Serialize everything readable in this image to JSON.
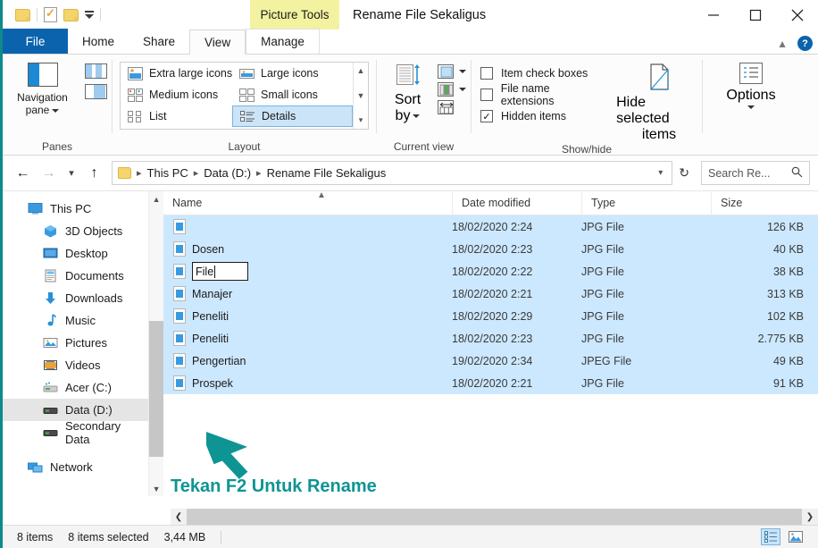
{
  "window": {
    "title": "Rename File Sekaligus",
    "contextual_tab": "Picture Tools",
    "minimize_icon": "minimize-icon",
    "maximize_icon": "maximize-icon",
    "close_icon": "close-icon"
  },
  "quick_access": {
    "folder_icon": "folder-icon",
    "properties_icon": "properties-icon",
    "new_folder_icon": "new-folder-icon",
    "customize_icon": "chevron-down-icon"
  },
  "tabs": [
    {
      "label": "File",
      "state": "file"
    },
    {
      "label": "Home",
      "state": "normal"
    },
    {
      "label": "Share",
      "state": "normal"
    },
    {
      "label": "View",
      "state": "active"
    },
    {
      "label": "Manage",
      "state": "contextual"
    }
  ],
  "ribbon": {
    "collapse_icon": "chevron-up-icon",
    "help_label": "?",
    "groups": {
      "panes": {
        "label": "Panes",
        "navigation_pane": "Navigation\npane",
        "navigation_pane_line1": "Navigation",
        "navigation_pane_line2": "pane"
      },
      "layout": {
        "label": "Layout",
        "items": [
          {
            "label": "Extra large icons",
            "selected": false
          },
          {
            "label": "Large icons",
            "selected": false
          },
          {
            "label": "Medium icons",
            "selected": false
          },
          {
            "label": "Small icons",
            "selected": false
          },
          {
            "label": "List",
            "selected": false
          },
          {
            "label": "Details",
            "selected": true
          }
        ]
      },
      "current_view": {
        "label": "Current view",
        "sort_by_line1": "Sort",
        "sort_by_line2": "by"
      },
      "show_hide": {
        "label": "Show/hide",
        "checkboxes": [
          {
            "label": "Item check boxes",
            "checked": false
          },
          {
            "label": "File name extensions",
            "checked": false
          },
          {
            "label": "Hidden items",
            "checked": true
          }
        ],
        "hide_selected_line1": "Hide selected",
        "hide_selected_line2": "items"
      },
      "options": {
        "label": "Options"
      }
    }
  },
  "address": {
    "back_icon": "back-arrow-icon",
    "forward_icon": "forward-arrow-icon",
    "recent_icon": "chevron-down-icon",
    "up_icon": "up-arrow-icon",
    "breadcrumb": [
      "This PC",
      "Data  (D:)",
      "Rename File Sekaligus"
    ],
    "dropdown_icon": "chevron-down-icon",
    "refresh_icon": "refresh-icon",
    "search_placeholder": "Search Re...",
    "search_icon": "search-icon"
  },
  "sidebar": {
    "items": [
      {
        "label": "This PC",
        "icon": "this-pc-icon",
        "indent": 0,
        "selected": false
      },
      {
        "label": "3D Objects",
        "icon": "3d-objects-icon",
        "indent": 1,
        "selected": false
      },
      {
        "label": "Desktop",
        "icon": "desktop-icon",
        "indent": 1,
        "selected": false
      },
      {
        "label": "Documents",
        "icon": "documents-icon",
        "indent": 1,
        "selected": false
      },
      {
        "label": "Downloads",
        "icon": "downloads-icon",
        "indent": 1,
        "selected": false
      },
      {
        "label": "Music",
        "icon": "music-icon",
        "indent": 1,
        "selected": false
      },
      {
        "label": "Pictures",
        "icon": "pictures-icon",
        "indent": 1,
        "selected": false
      },
      {
        "label": "Videos",
        "icon": "videos-icon",
        "indent": 1,
        "selected": false
      },
      {
        "label": "Acer (C:)",
        "icon": "drive-icon",
        "indent": 1,
        "selected": false
      },
      {
        "label": "Data  (D:)",
        "icon": "drive-icon",
        "indent": 1,
        "selected": true
      },
      {
        "label": "Secondary Data",
        "icon": "drive-icon",
        "indent": 1,
        "selected": false
      },
      {
        "label": "Network",
        "icon": "network-icon",
        "indent": 0,
        "selected": false
      }
    ],
    "scroll_up_icon": "chevron-up-icon",
    "scroll_down_icon": "chevron-down-icon"
  },
  "filelist": {
    "columns": [
      "Name",
      "Date modified",
      "Type",
      "Size"
    ],
    "sort_indicator": "ascending",
    "rows": [
      {
        "name": "",
        "date": "18/02/2020 2:24",
        "type": "JPG File",
        "size": "126 KB",
        "editing": false
      },
      {
        "name": "Dosen",
        "date": "18/02/2020 2:23",
        "type": "JPG File",
        "size": "40 KB",
        "editing": false
      },
      {
        "name": "File",
        "date": "18/02/2020 2:22",
        "type": "JPG File",
        "size": "38 KB",
        "editing": true
      },
      {
        "name": "Manajer",
        "date": "18/02/2020 2:21",
        "type": "JPG File",
        "size": "313 KB",
        "editing": false
      },
      {
        "name": "Peneliti",
        "date": "18/02/2020 2:29",
        "type": "JPG File",
        "size": "102 KB",
        "editing": false
      },
      {
        "name": "Peneliti",
        "date": "18/02/2020 2:23",
        "type": "JPG File",
        "size": "2.775 KB",
        "editing": false
      },
      {
        "name": "Pengertian",
        "date": "19/02/2020 2:34",
        "type": "JPEG File",
        "size": "49 KB",
        "editing": false
      },
      {
        "name": "Prospek",
        "date": "18/02/2020 2:21",
        "type": "JPG File",
        "size": "91 KB",
        "editing": false
      }
    ],
    "hscroll_left_icon": "chevron-left-icon",
    "hscroll_right_icon": "chevron-right-icon"
  },
  "annotation": {
    "text": "Tekan F2 Untuk Rename",
    "color": "#0f9494",
    "cursor_icon": "arrow-cursor-icon"
  },
  "statusbar": {
    "item_count": "8 items",
    "selected_count": "8 items selected",
    "total_size": "3,44 MB",
    "details_view_icon": "details-view-icon",
    "large_icons_view_icon": "large-icons-view-icon"
  }
}
